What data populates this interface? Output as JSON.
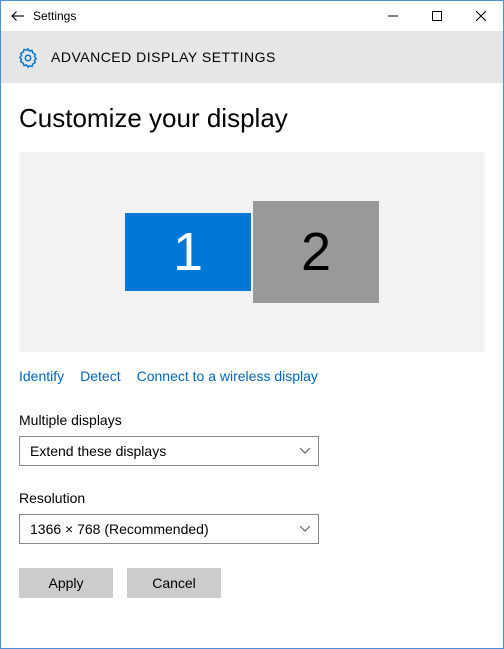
{
  "window": {
    "title": "Settings"
  },
  "header": {
    "title": "ADVANCED DISPLAY SETTINGS"
  },
  "page": {
    "title": "Customize your display"
  },
  "displays": {
    "monitor1": "1",
    "monitor2": "2"
  },
  "links": {
    "identify": "Identify",
    "detect": "Detect",
    "wireless": "Connect to a wireless display"
  },
  "multiple": {
    "label": "Multiple displays",
    "value": "Extend these displays"
  },
  "resolution": {
    "label": "Resolution",
    "value": "1366 × 768 (Recommended)"
  },
  "buttons": {
    "apply": "Apply",
    "cancel": "Cancel"
  }
}
